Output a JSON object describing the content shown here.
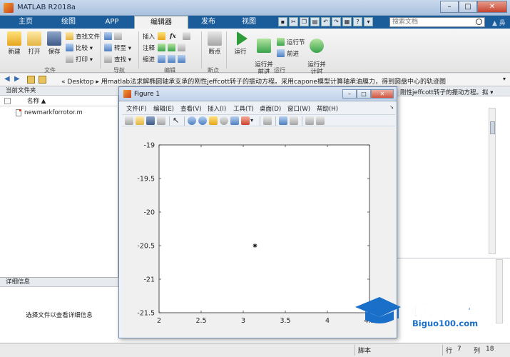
{
  "window": {
    "title": "MATLAB R2018a",
    "min_label": "–",
    "max_label": "□",
    "close_label": "✕"
  },
  "ribbon_tabs": [
    {
      "label": "主页"
    },
    {
      "label": "绘图"
    },
    {
      "label": "APP"
    },
    {
      "label": "编辑器"
    },
    {
      "label": "发布"
    },
    {
      "label": "视图"
    }
  ],
  "search": {
    "placeholder": "搜索文档",
    "collapse_label": "▲ 鼻夹"
  },
  "ribbon": {
    "file_group": {
      "new": "新建",
      "open": "打开",
      "save": "保存",
      "find_files": "查找文件",
      "compare": "比较 ▾",
      "print": "打印 ▾",
      "label": "文件"
    },
    "nav_group": {
      "goto": "转至 ▾",
      "find": "查找 ▾",
      "label": "导航"
    },
    "edit_group": {
      "insert": "插入",
      "comment": "注释",
      "indent": "缩进",
      "fx": "fx",
      "label": "编辑"
    },
    "breakpoint_group": {
      "breakpoints": "断点",
      "label": "断点"
    },
    "run_group": {
      "run": "运行",
      "run_advance": "运行并\n前进",
      "run_section": "运行节",
      "advance": "前进",
      "run_time": "运行并\n计时",
      "label": "运行"
    }
  },
  "addressbar": {
    "path": "« Desktop ▸ 用matlab法求解椭圆轴承支承的刚性jeffcott转子的振动方程。采用capone模型计算轴承油膜力，得到圆盘中心的轨迹图"
  },
  "current_folder": {
    "header": "当前文件夹",
    "column_name": "名称 ▲",
    "files": [
      {
        "name": "newmarkforrotor.m"
      }
    ]
  },
  "details": {
    "header": "详细信息",
    "hint": "选择文件以查看详细信息"
  },
  "editor": {
    "tab_text": "刚性jeffcott转子的振动方程。拟 ▾"
  },
  "statusbar": {
    "mode": "脚本",
    "row_label": "行",
    "row": "7",
    "col_label": "列",
    "col": "18"
  },
  "figure": {
    "title": "Figure 1",
    "menu": [
      {
        "label": "文件(F)"
      },
      {
        "label": "编辑(E)"
      },
      {
        "label": "查看(V)"
      },
      {
        "label": "插入(I)"
      },
      {
        "label": "工具(T)"
      },
      {
        "label": "桌面(D)"
      },
      {
        "label": "窗口(W)"
      },
      {
        "label": "帮助(H)"
      }
    ]
  },
  "chart_data": {
    "type": "scatter",
    "title": "",
    "xlabel": "",
    "ylabel": "",
    "xlim": [
      2,
      4.5
    ],
    "ylim": [
      -21.5,
      -19
    ],
    "xticks": [
      2,
      2.5,
      3,
      3.5,
      4,
      4.5
    ],
    "xtick_labels": [
      "2",
      "2.5",
      "3",
      "3.5",
      "4",
      "4.5"
    ],
    "yticks": [
      -19,
      -19.5,
      -20,
      -20.5,
      -21,
      -21.5
    ],
    "ytick_labels": [
      "-19",
      "-19.5",
      "-20",
      "-20.5",
      "-21",
      "-21.5"
    ],
    "grid": false,
    "marker": "*",
    "points": [
      {
        "x": 3.14,
        "y": -20.5
      }
    ]
  },
  "watermark": {
    "cn": "必过源码",
    "en": "Biguo100.com"
  }
}
